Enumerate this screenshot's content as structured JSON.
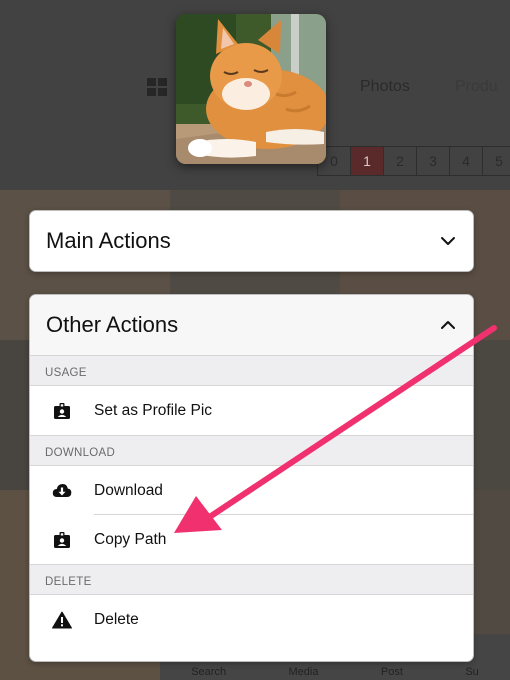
{
  "background": {
    "tabs": [
      "Photos",
      "Produ"
    ],
    "pager": [
      "0",
      "1",
      "2",
      "3",
      "4",
      "5"
    ],
    "active_page": "1",
    "bottom_nav": [
      "Search",
      "Media",
      "Post",
      "Su"
    ]
  },
  "main_actions": {
    "title": "Main Actions",
    "icon": "chevron-down-icon"
  },
  "other_actions": {
    "title": "Other Actions",
    "icon": "chevron-up-icon",
    "sections": {
      "usage": {
        "label": "USAGE",
        "items": [
          {
            "label": "Set as Profile Pic",
            "icon": "id-badge-icon"
          }
        ]
      },
      "download": {
        "label": "DOWNLOAD",
        "items": [
          {
            "label": "Download",
            "icon": "cloud-download-icon"
          },
          {
            "label": "Copy Path",
            "icon": "id-badge-icon"
          }
        ]
      },
      "delete": {
        "label": "DELETE",
        "items": [
          {
            "label": "Delete",
            "icon": "warning-icon"
          }
        ]
      }
    }
  },
  "annotation": {
    "arrow_color": "#f0306f",
    "points_to": "Copy Path"
  }
}
